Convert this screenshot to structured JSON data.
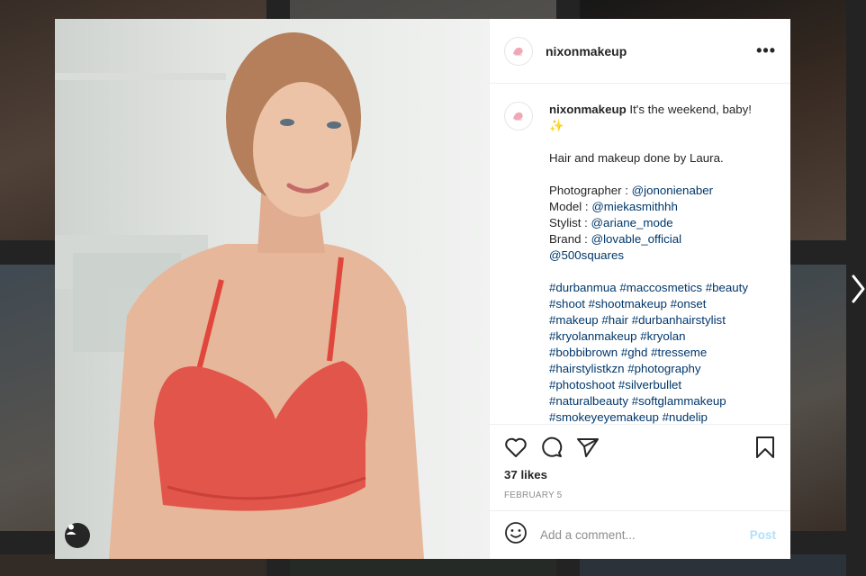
{
  "colors": {
    "accent_link": "#00376b",
    "post_disabled": "#b2dffc",
    "overlay": "#000000"
  },
  "post": {
    "username": "nixonmakeup",
    "more_icon": "more-horizontal-icon",
    "tag_icon": "user-tag-icon",
    "caption": {
      "username": "nixonmakeup",
      "line1": " It's the weekend, baby!",
      "emoji": "✨",
      "line2": "Hair and makeup done by Laura.",
      "credits": [
        {
          "label": "Photographer : ",
          "handle": "@jononienaber"
        },
        {
          "label": "Model : ",
          "handle": "@miekasmithhh"
        },
        {
          "label": "Stylist : ",
          "handle": "@ariane_mode"
        },
        {
          "label": "Brand : ",
          "handle": "@lovable_official"
        },
        {
          "label": "",
          "handle": "@500squares"
        }
      ],
      "hashtag_lines": [
        [
          "#durbanmua",
          "#maccosmetics",
          "#beauty"
        ],
        [
          "#shoot",
          "#shootmakeup",
          "#onset"
        ],
        [
          "#makeup",
          "#hair",
          "#durbanhairstylist"
        ],
        [
          "#kryolanmakeup",
          "#kryolan"
        ],
        [
          "#bobbibrown",
          "#ghd",
          "#tresseme"
        ],
        [
          "#hairstylistkzn",
          "#photography"
        ],
        [
          "#photoshoot",
          "#silverbullet"
        ],
        [
          "#naturalbeauty",
          "#softglammakeup"
        ],
        [
          "#smokeyeyemakeup",
          "#nudelip"
        ]
      ]
    },
    "likes": "37 likes",
    "date": "FEBRUARY 5",
    "comment_placeholder": "Add a comment...",
    "post_label": "Post",
    "icons": {
      "like": "heart-icon",
      "comment": "comment-icon",
      "share": "share-icon",
      "save": "bookmark-icon",
      "emoji": "emoji-icon",
      "next": "chevron-right-icon"
    }
  }
}
